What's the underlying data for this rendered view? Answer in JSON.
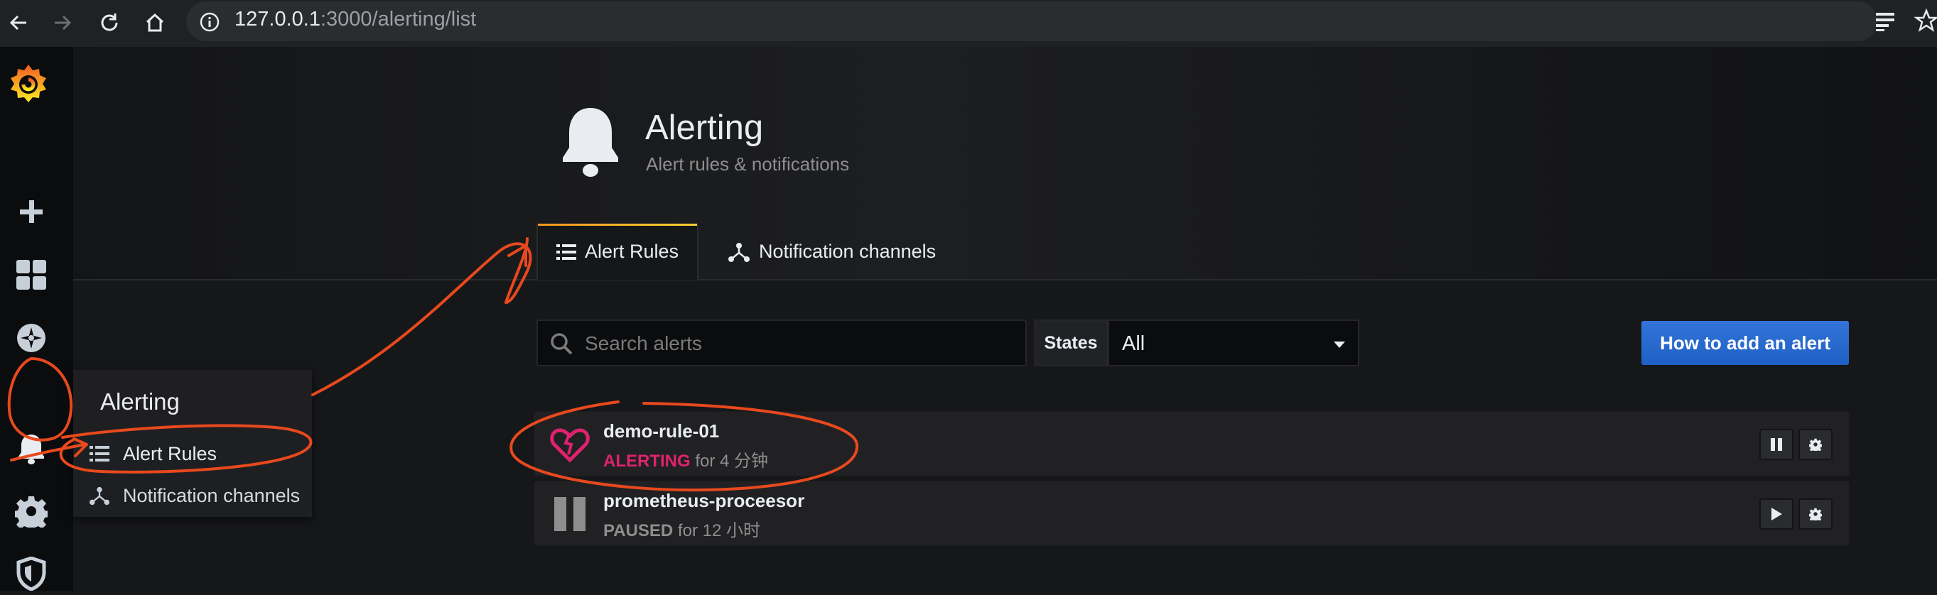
{
  "browser": {
    "url_host": "127.0.0.1",
    "url_path": ":3000/alerting/list"
  },
  "sidebar": {
    "items": [
      {
        "icon": "grafana-logo-icon"
      },
      {
        "icon": "plus-icon"
      },
      {
        "icon": "dashboards-icon"
      },
      {
        "icon": "explore-compass-icon"
      },
      {
        "icon": "bell-icon"
      },
      {
        "icon": "gear-icon"
      },
      {
        "icon": "shield-icon"
      }
    ]
  },
  "flyout": {
    "title": "Alerting",
    "items": [
      {
        "label": "Alert Rules",
        "icon": "list-icon"
      },
      {
        "label": "Notification channels",
        "icon": "channels-icon"
      }
    ]
  },
  "header": {
    "title": "Alerting",
    "subtitle": "Alert rules & notifications",
    "tabs": [
      {
        "label": "Alert Rules",
        "active": true
      },
      {
        "label": "Notification channels",
        "active": false
      }
    ]
  },
  "toolbar": {
    "search_placeholder": "Search alerts",
    "states_label": "States",
    "states_value": "All",
    "add_button": "How to add an alert"
  },
  "rules": [
    {
      "name": "demo-rule-01",
      "state": "ALERTING",
      "duration": "for 4 分钟",
      "action": "pause"
    },
    {
      "name": "prometheus-proceesor",
      "state": "PAUSED",
      "duration": "for 12 小时",
      "action": "play"
    }
  ],
  "colors": {
    "alerting": "#e0226e",
    "primary_button": "#3274d9",
    "annotation": "#e8491d"
  }
}
